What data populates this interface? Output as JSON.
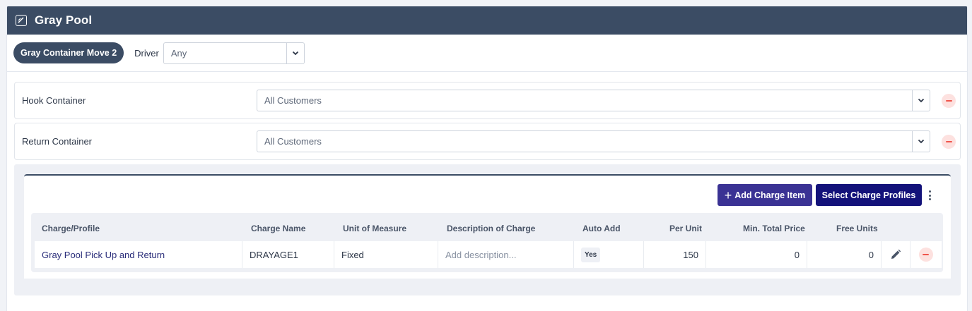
{
  "header": {
    "title": "Gray Pool",
    "icon": "edit-square-icon"
  },
  "toolbar": {
    "move_label": "Gray Container Move 2",
    "driver_label": "Driver",
    "driver_value": "Any"
  },
  "events": [
    {
      "label": "Hook Container",
      "customer_value": "All Customers"
    },
    {
      "label": "Return Container",
      "customer_value": "All Customers"
    }
  ],
  "charges": {
    "add_label": "Add Charge Item",
    "profiles_label": "Select Charge Profiles",
    "columns": [
      "Charge/Profile",
      "Charge Name",
      "Unit of Measure",
      "Description of Charge",
      "Auto Add",
      "Per Unit",
      "Min. Total Price",
      "Free Units"
    ],
    "rows": [
      {
        "profile": "Gray Pool Pick Up and Return",
        "charge_name": "DRAYAGE1",
        "unit": "Fixed",
        "description_placeholder": "Add description...",
        "auto_add": "Yes",
        "per_unit": "150",
        "min_total": "0",
        "free_units": "0"
      }
    ]
  },
  "colors": {
    "header_bg": "#3b4c64",
    "primary_button": "#3a3294",
    "secondary_button": "#13127a",
    "danger": "#f0554b"
  }
}
